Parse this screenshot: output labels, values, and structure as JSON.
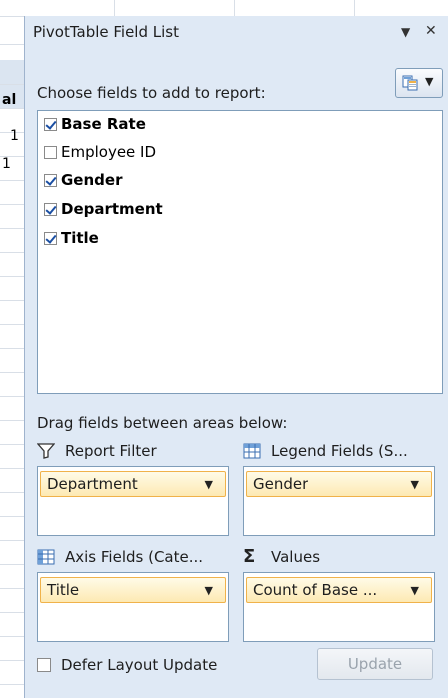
{
  "sheet": {
    "cells": [
      "al",
      "1",
      "1"
    ]
  },
  "pane": {
    "title": "PivotTable Field List",
    "dropdown_glyph": "▼",
    "close_glyph": "✕",
    "choose_label": "Choose fields to add to report:",
    "layout_button_icon": "field-list-layout-icon"
  },
  "fields": [
    {
      "label": "Base Rate",
      "checked": true
    },
    {
      "label": "Employee ID",
      "checked": false
    },
    {
      "label": "Gender",
      "checked": true
    },
    {
      "label": "Department",
      "checked": true
    },
    {
      "label": "Title",
      "checked": true
    }
  ],
  "areas": {
    "drag_label": "Drag fields between areas below:",
    "report_filter": {
      "header": "Report Filter",
      "icon": "filter-icon",
      "item": "Department"
    },
    "legend_fields": {
      "header": "Legend Fields (S...",
      "icon": "table-grid-icon",
      "item": "Gender"
    },
    "axis_fields": {
      "header": "Axis Fields (Cate...",
      "icon": "table-grid-icon",
      "item": "Title"
    },
    "values": {
      "header": "Values",
      "icon": "sigma-icon",
      "item": "Count of Base ..."
    }
  },
  "footer": {
    "defer_label": "Defer Layout Update",
    "defer_checked": false,
    "update_label": "Update"
  },
  "colors": {
    "pane_bg": "#dfe9f5",
    "pill_border": "#f0b24a",
    "check_blue": "#1b4fa3"
  }
}
